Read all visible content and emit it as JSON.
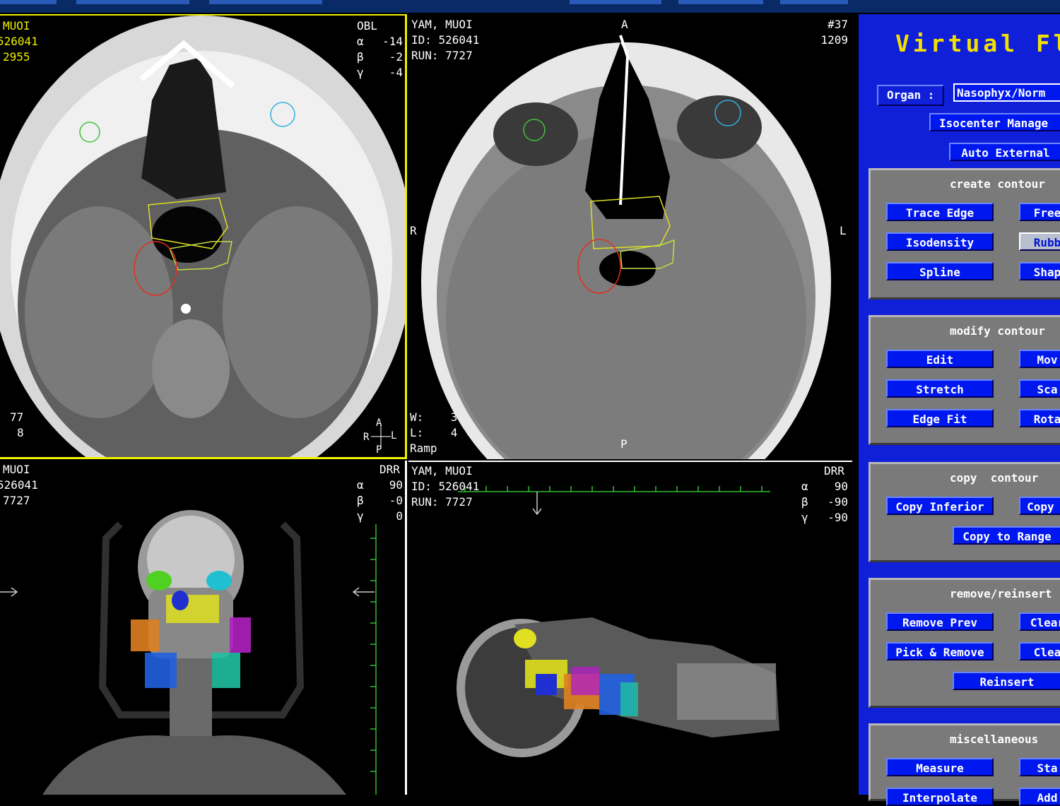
{
  "viewports": {
    "top_left": {
      "name": "MUOI",
      "id": "526041",
      "run": "2955",
      "mode": "OBL",
      "angles": [
        {
          "sym": "α",
          "val": "-14"
        },
        {
          "sym": "β",
          "val": "-2"
        },
        {
          "sym": "γ",
          "val": "-4"
        }
      ],
      "bottom_left_1": "77",
      "bottom_left_2": "8",
      "orientation": {
        "up": "A",
        "down": "P",
        "left": "R",
        "right": "L"
      }
    },
    "top_right": {
      "name": "YAM, MUOI",
      "id_line": "ID: 526041",
      "run_line": "RUN: 7727",
      "top_marker": "A",
      "bottom_marker": "P",
      "left_marker": "R",
      "right_marker": "L",
      "slice": "#37",
      "slice_pos": "1209",
      "window_line": "W:    3",
      "level_line": "L:    4",
      "lut": "Ramp"
    },
    "bottom_left": {
      "name": "MUOI",
      "id": "526041",
      "run": "7727",
      "mode": "DRR",
      "angles": [
        {
          "sym": "α",
          "val": "90"
        },
        {
          "sym": "β",
          "val": "-0"
        },
        {
          "sym": "γ",
          "val": "0"
        }
      ]
    },
    "bottom_right": {
      "name": "YAM, MUOI",
      "id_line": "ID: 526041",
      "run_line": "RUN: 7727",
      "mode": "DRR",
      "angles": [
        {
          "sym": "α",
          "val": "90"
        },
        {
          "sym": "β",
          "val": "-90"
        },
        {
          "sym": "γ",
          "val": "-90"
        }
      ]
    }
  },
  "panel": {
    "title": "Virtual Flu",
    "organ_label": "Organ :",
    "organ_value": "Nasophyx/Norm",
    "isocenter_button": "Isocenter Manage",
    "auto_external_button": "Auto External",
    "groups": {
      "create": {
        "title": "create contour",
        "buttons": [
          "Trace Edge",
          "Free",
          "Isodensity",
          "Rubb",
          "Spline",
          "Shap"
        ]
      },
      "modify": {
        "title": "modify contour",
        "buttons": [
          "Edit",
          "Mov",
          "Stretch",
          "Sca",
          "Edge Fit",
          "Rota"
        ]
      },
      "copy": {
        "title": "copy  contour",
        "buttons": [
          "Copy Inferior",
          "Copy S",
          "Copy to Range"
        ]
      },
      "remove": {
        "title": "remove/reinsert",
        "buttons": [
          "Remove Prev",
          "Clear",
          "Pick & Remove",
          "Clea",
          "Reinsert"
        ]
      },
      "misc": {
        "title": "miscellaneous",
        "buttons": [
          "Measure",
          "Sta",
          "Interpolate",
          "Add"
        ]
      }
    }
  },
  "colors": {
    "panel_bg": "#1020d8",
    "button": "#0018f0",
    "title": "#f4e000",
    "active_border": "#f0f000"
  }
}
